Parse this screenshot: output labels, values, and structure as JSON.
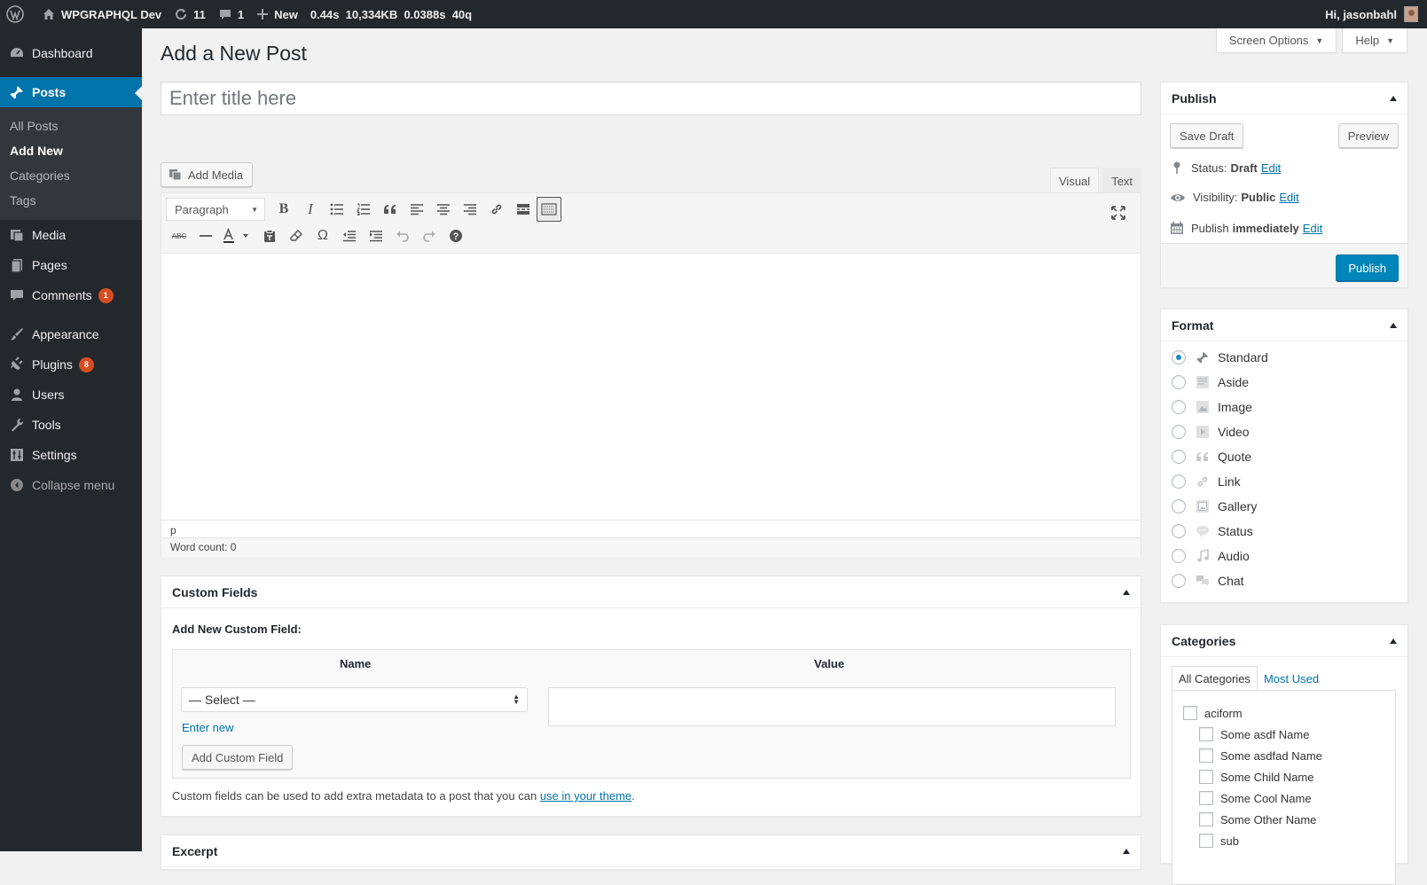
{
  "adminbar": {
    "site_name": "WPGRAPHQL Dev",
    "updates_count": "11",
    "comments_count": "1",
    "new_label": "New",
    "stat_time": "0.44s",
    "stat_memory": "10,334KB",
    "stat_query_time": "0.0388s",
    "stat_queries": "40q",
    "greeting": "Hi, jasonbahl"
  },
  "menu": {
    "dashboard": "Dashboard",
    "posts": "Posts",
    "posts_sub": [
      "All Posts",
      "Add New",
      "Categories",
      "Tags"
    ],
    "media": "Media",
    "pages": "Pages",
    "comments": "Comments",
    "comments_badge": "1",
    "appearance": "Appearance",
    "plugins": "Plugins",
    "plugins_badge": "8",
    "users": "Users",
    "tools": "Tools",
    "settings": "Settings",
    "collapse": "Collapse menu"
  },
  "screen_options": {
    "screen_options_label": "Screen Options",
    "help_label": "Help"
  },
  "page": {
    "title": "Add a New Post",
    "title_placeholder": "Enter title here"
  },
  "editor": {
    "add_media_label": "Add Media",
    "tab_visual": "Visual",
    "tab_text": "Text",
    "format_select": "Paragraph",
    "path": "p",
    "word_count": "Word count: 0"
  },
  "custom_fields": {
    "title": "Custom Fields",
    "subtitle": "Add New Custom Field:",
    "col_name": "Name",
    "col_value": "Value",
    "select_value": "— Select —",
    "enter_new": "Enter new",
    "add_button": "Add Custom Field",
    "help_prefix": "Custom fields can be used to add extra metadata to a post that you can ",
    "help_link": "use in your theme",
    "help_suffix": "."
  },
  "excerpt": {
    "title": "Excerpt"
  },
  "publish": {
    "title": "Publish",
    "save_draft": "Save Draft",
    "preview": "Preview",
    "status_label": "Status:",
    "status_value": "Draft",
    "visibility_label": "Visibility:",
    "visibility_value": "Public",
    "schedule_label": "Publish",
    "schedule_value": "immediately",
    "edit_link": "Edit",
    "publish_button": "Publish"
  },
  "format": {
    "title": "Format",
    "options": [
      "Standard",
      "Aside",
      "Image",
      "Video",
      "Quote",
      "Link",
      "Gallery",
      "Status",
      "Audio",
      "Chat"
    ],
    "selected": "Standard"
  },
  "categories": {
    "title": "Categories",
    "tab_all": "All Categories",
    "tab_most_used": "Most Used",
    "items": [
      "aciform",
      "Some asdf Name",
      "Some asdfad Name",
      "Some Child Name",
      "Some Cool Name",
      "Some Other Name",
      "sub"
    ]
  },
  "colors": {
    "admin_dark": "#23282d",
    "accent": "#0073aa",
    "publish_button": "#0085ba",
    "badge": "#d54e21"
  }
}
